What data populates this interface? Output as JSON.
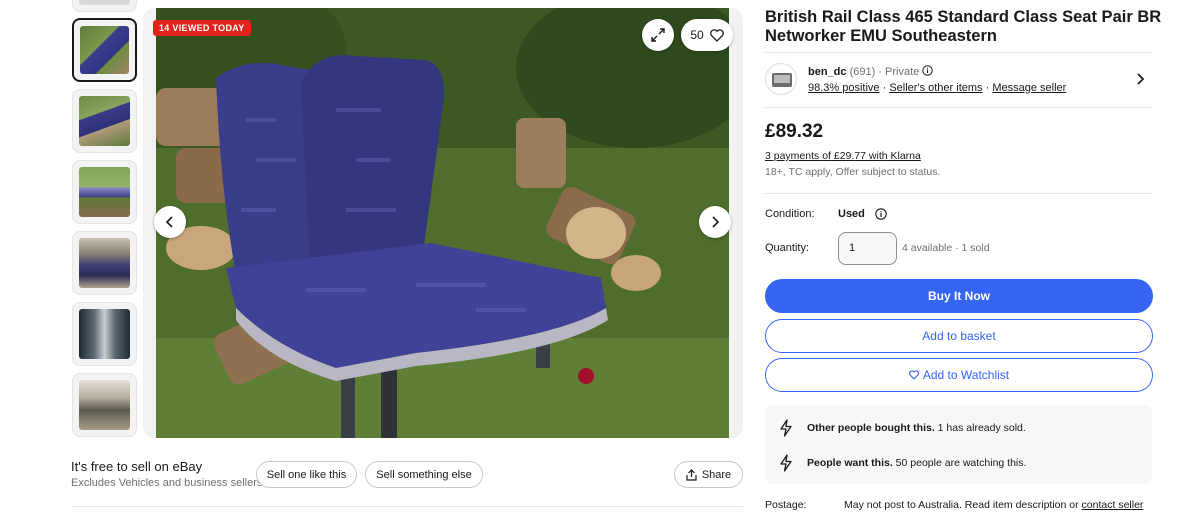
{
  "colors": {
    "primary": "#3665f3",
    "badge_red": "#e0231b",
    "text": "#191919",
    "muted": "#707070"
  },
  "gallery": {
    "badge": "14 VIEWED TODAY",
    "watch_count": "50",
    "thumbnails": [
      {
        "icon": "seat-pair-front-thumbnail",
        "selected": true
      },
      {
        "icon": "seat-pair-side-thumbnail"
      },
      {
        "icon": "seat-pair-garden-thumbnail"
      },
      {
        "icon": "train-interior-thumbnail"
      },
      {
        "icon": "train-carriage-thumbnail"
      },
      {
        "icon": "train-ceiling-thumbnail"
      }
    ]
  },
  "sell": {
    "title": "It's free to sell on eBay",
    "subtitle": "Excludes Vehicles and business sellers",
    "sell_one": "Sell one like this",
    "sell_else": "Sell something else",
    "share": "Share"
  },
  "listing": {
    "title": "British Rail Class 465 Standard Class Seat Pair BR Networker EMU Southeastern",
    "price": "£89.32",
    "klarna": "3 payments of £29.77 with Klarna",
    "terms": "18+, TC apply, Offer subject to status.",
    "condition_label": "Condition:",
    "condition_value": "Used",
    "quantity_label": "Quantity:",
    "quantity_value": "1",
    "availability": "4 available · 1 sold",
    "buy_now": "Buy It Now",
    "add_basket": "Add to basket",
    "add_watchlist": "Add to Watchlist",
    "postage_label": "Postage:",
    "postage_text": "May not post to Australia. Read item description or",
    "postage_link": "contact seller"
  },
  "seller": {
    "name": "ben_dc",
    "feedback_count": "(691)",
    "type": "· Private",
    "positive": "98.3% positive",
    "other_items": "Seller's other items",
    "message": "Message seller"
  },
  "signals": {
    "bought_bold": "Other people bought this.",
    "bought_rest": " 1 has already sold.",
    "want_bold": "People want this.",
    "want_rest": " 50 people are watching this."
  }
}
